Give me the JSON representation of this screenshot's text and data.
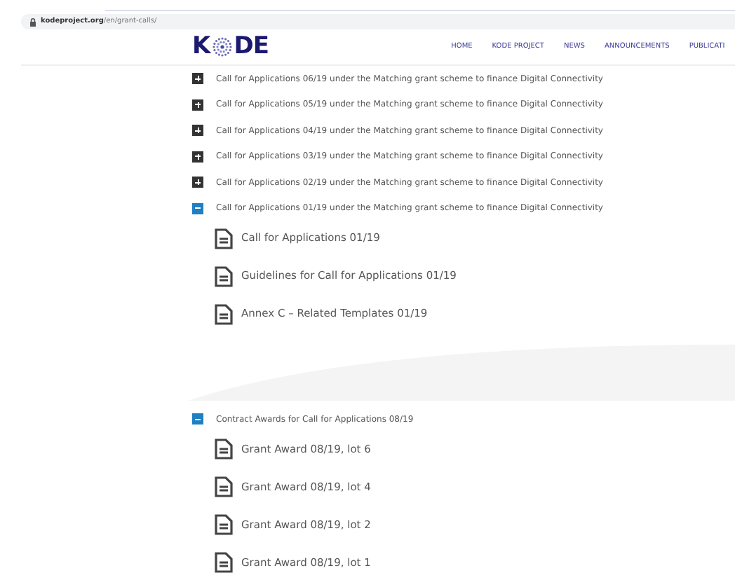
{
  "address_bar": {
    "url_host": "kodeproject.org",
    "url_path": "/en/grant-calls/"
  },
  "header": {
    "logo": {
      "left": "K",
      "right": "DE"
    },
    "nav": [
      {
        "label": "HOME"
      },
      {
        "label": "KODE PROJECT"
      },
      {
        "label": "NEWS"
      },
      {
        "label": "ANNOUNCEMENTS"
      },
      {
        "label": "PUBLICATI"
      }
    ]
  },
  "calls": [
    {
      "title": "Call for Applications 06/19 under the Matching grant scheme to finance Digital Connectivity",
      "expanded": false
    },
    {
      "title": "Call for Applications 05/19 under the Matching grant scheme to finance Digital Connectivity",
      "expanded": false
    },
    {
      "title": "Call for Applications 04/19 under the Matching grant scheme to finance Digital Connectivity",
      "expanded": false
    },
    {
      "title": "Call for Applications 03/19 under the Matching grant scheme to finance Digital Connectivity",
      "expanded": false
    },
    {
      "title": "Call for Applications 02/19 under the Matching grant scheme to finance Digital Connectivity",
      "expanded": false
    },
    {
      "title": "Call for Applications 01/19 under the Matching grant scheme to finance Digital Connectivity",
      "expanded": true,
      "documents": [
        "Call for Applications 01/19",
        "Guidelines for Call for Applications 01/19",
        "Annex C – Related Templates 01/19"
      ]
    }
  ],
  "awards": [
    {
      "title": "Contract Awards for Call for Applications 08/19",
      "expanded": true,
      "documents": [
        "Grant Award 08/19, lot 6",
        "Grant Award 08/19, lot 4",
        "Grant Award 08/19, lot 2",
        "Grant Award 08/19, lot 1"
      ]
    }
  ]
}
